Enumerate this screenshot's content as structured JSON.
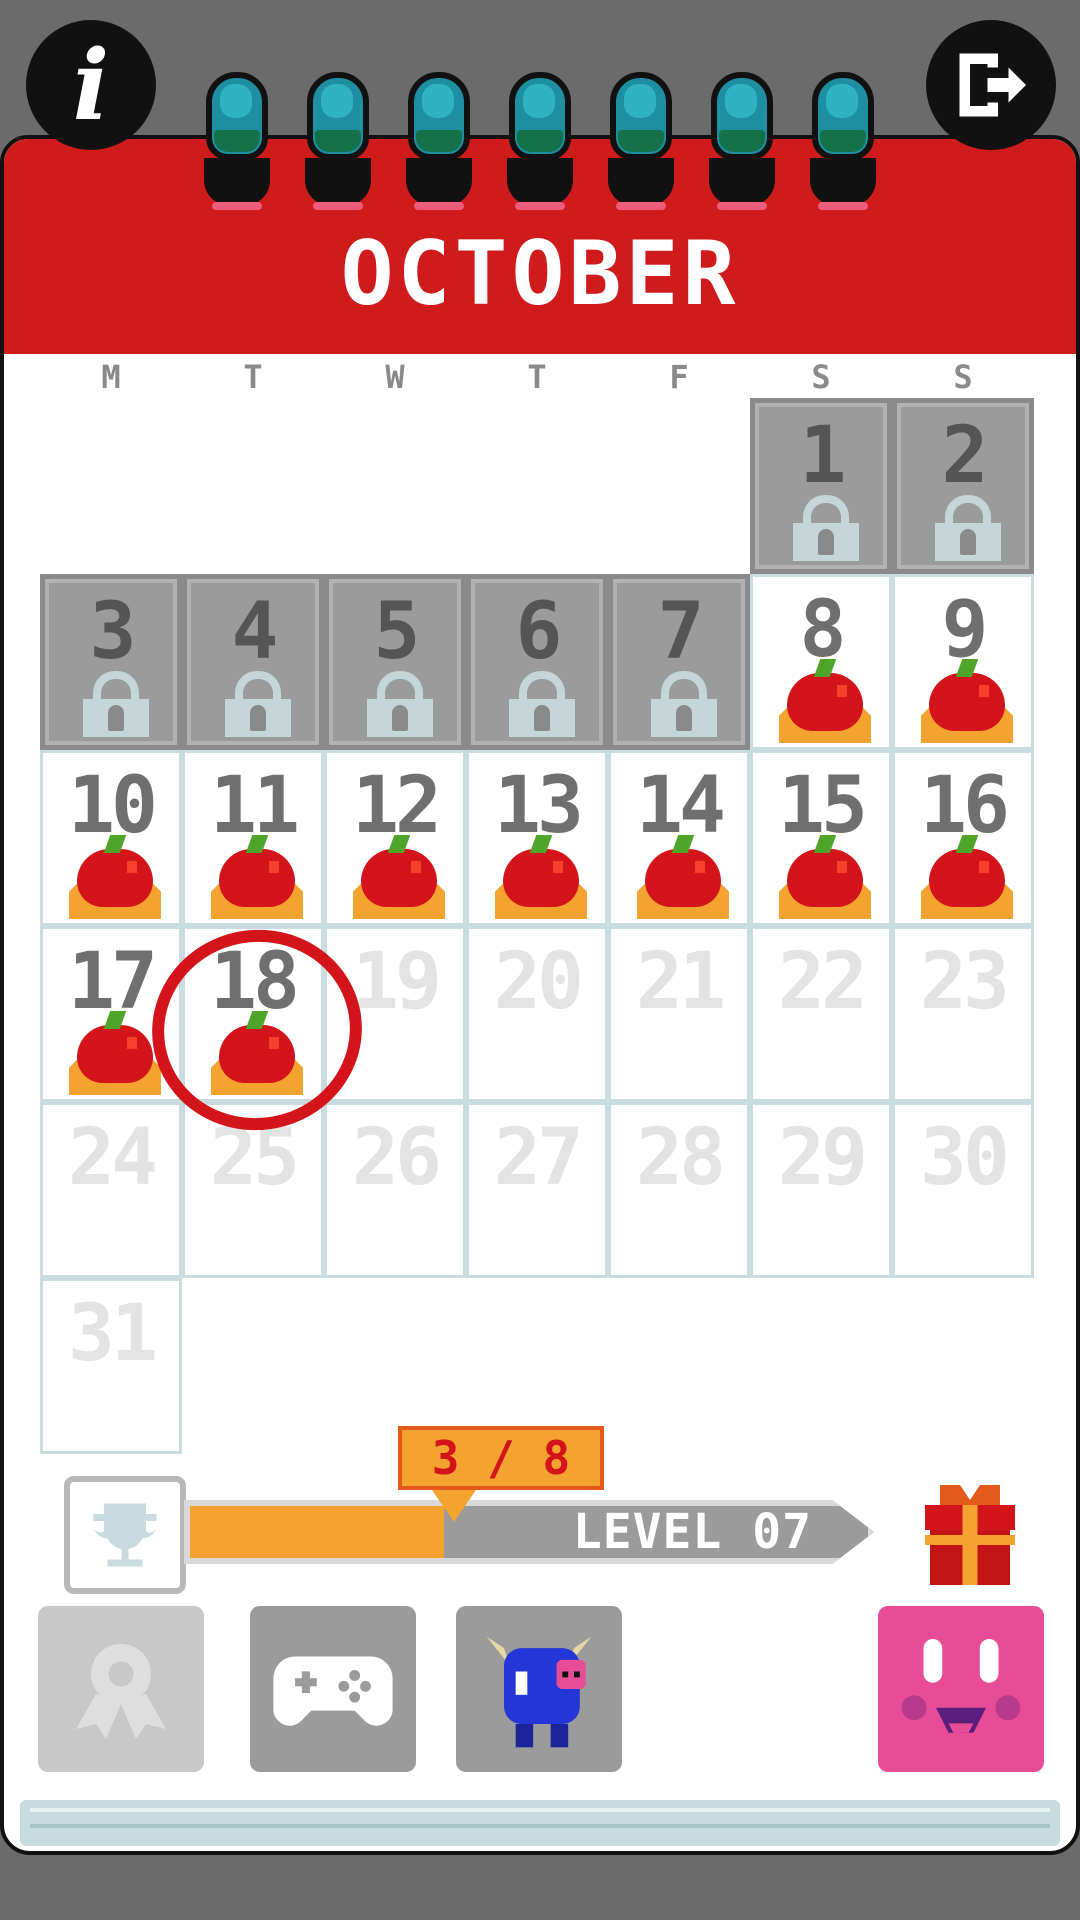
{
  "calendar": {
    "month": "OCTOBER",
    "weekdays": [
      "M",
      "T",
      "W",
      "T",
      "F",
      "S",
      "S"
    ],
    "days": [
      {
        "day": "1",
        "state": "locked"
      },
      {
        "day": "2",
        "state": "locked"
      },
      {
        "day": "3",
        "state": "locked"
      },
      {
        "day": "4",
        "state": "locked"
      },
      {
        "day": "5",
        "state": "locked"
      },
      {
        "day": "6",
        "state": "locked"
      },
      {
        "day": "7",
        "state": "locked"
      },
      {
        "day": "8",
        "state": "completed"
      },
      {
        "day": "9",
        "state": "completed"
      },
      {
        "day": "10",
        "state": "completed"
      },
      {
        "day": "11",
        "state": "completed"
      },
      {
        "day": "12",
        "state": "completed"
      },
      {
        "day": "13",
        "state": "completed"
      },
      {
        "day": "14",
        "state": "completed"
      },
      {
        "day": "15",
        "state": "completed"
      },
      {
        "day": "16",
        "state": "completed"
      },
      {
        "day": "17",
        "state": "completed"
      },
      {
        "day": "18",
        "state": "today"
      },
      {
        "day": "19",
        "state": "future"
      },
      {
        "day": "20",
        "state": "future"
      },
      {
        "day": "21",
        "state": "future"
      },
      {
        "day": "22",
        "state": "future"
      },
      {
        "day": "23",
        "state": "future"
      },
      {
        "day": "24",
        "state": "future"
      },
      {
        "day": "25",
        "state": "future"
      },
      {
        "day": "26",
        "state": "future"
      },
      {
        "day": "27",
        "state": "future"
      },
      {
        "day": "28",
        "state": "future"
      },
      {
        "day": "29",
        "state": "future"
      },
      {
        "day": "30",
        "state": "future"
      },
      {
        "day": "31",
        "state": "future"
      }
    ]
  },
  "progress": {
    "tag": "3 / 8",
    "current": 3,
    "total": 8,
    "level_label": "LEVEL 07"
  },
  "icons": {
    "info": "info-icon",
    "exit": "exit-icon",
    "trophy": "trophy-icon",
    "gift": "gift-icon",
    "badge": "ribbon-badge-icon",
    "games": "gamepad-icon",
    "character": "blue-monster-icon",
    "face": "pink-face-icon"
  },
  "colors": {
    "header_red": "#cf1b1b",
    "progress_orange": "#f4a230",
    "pink": "#e94c97"
  }
}
